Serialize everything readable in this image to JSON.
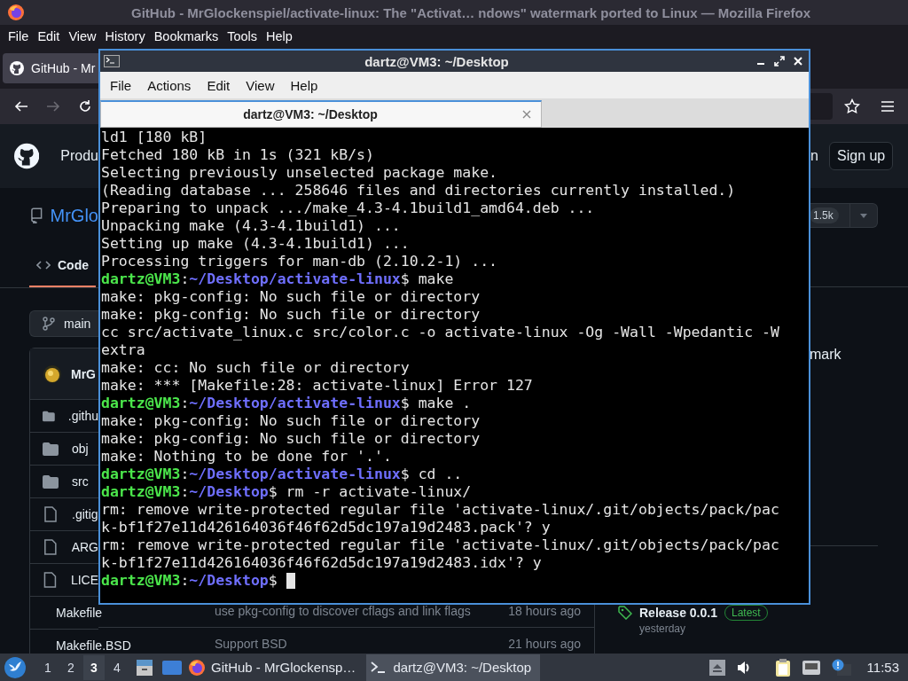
{
  "firefox": {
    "title": "GitHub - MrGlockenspiel/activate-linux: The \"Activat… ndows\" watermark ported to Linux — Mozilla Firefox",
    "menu": [
      {
        "label": "File"
      },
      {
        "label": "Edit"
      },
      {
        "label": "View"
      },
      {
        "label": "History"
      },
      {
        "label": "Bookmarks"
      },
      {
        "label": "Tools"
      },
      {
        "label": "Help"
      }
    ],
    "tab": {
      "label": "GitHub - Mr"
    },
    "forward_disabled": true
  },
  "github": {
    "header": {
      "nav_item": "Produ",
      "sign_in": "n",
      "sign_up": "Sign up"
    },
    "repo_name": "MrGlo",
    "tabs": [
      {
        "label": "Code",
        "selected": true
      }
    ],
    "star_count": "1.5k",
    "branch": "main",
    "about_text": "mark",
    "commit_author": "MrG",
    "files": [
      {
        "kind": "folder",
        "name": ".githu"
      },
      {
        "kind": "folder",
        "name": "obj"
      },
      {
        "kind": "folder",
        "name": "src"
      },
      {
        "kind": "file",
        "name": ".gitig"
      },
      {
        "kind": "file",
        "name": "ARG"
      },
      {
        "kind": "file",
        "name": "LICE"
      },
      {
        "kind": "file",
        "name": "Makefile"
      },
      {
        "kind": "file",
        "name": "Makefile.BSD"
      }
    ],
    "file_details": [
      {
        "message": "use pkg-config to discover cflags and link flags",
        "time": "18 hours ago"
      },
      {
        "message": "Support BSD",
        "time": "21 hours ago"
      }
    ],
    "release": {
      "name": "Release 0.0.1",
      "badge": "Latest",
      "date": "yesterday"
    }
  },
  "terminal": {
    "title": "dartz@VM3: ~/Desktop",
    "menu": [
      {
        "label": "File"
      },
      {
        "label": "Actions"
      },
      {
        "label": "Edit"
      },
      {
        "label": "View"
      },
      {
        "label": "Help"
      }
    ],
    "tabs": [
      {
        "label": "dartz@VM3: ~/Desktop",
        "selected": true
      }
    ],
    "lines": [
      {
        "kind": "output",
        "text": "ld1 [180 kB]"
      },
      {
        "kind": "output",
        "text": "Fetched 180 kB in 1s (321 kB/s)"
      },
      {
        "kind": "output",
        "text": "Selecting previously unselected package make."
      },
      {
        "kind": "output",
        "text": "(Reading database ... 258646 files and directories currently installed.)"
      },
      {
        "kind": "output",
        "text": "Preparing to unpack .../make_4.3-4.1build1_amd64.deb ..."
      },
      {
        "kind": "output",
        "text": "Unpacking make (4.3-4.1build1) ..."
      },
      {
        "kind": "output",
        "text": "Setting up make (4.3-4.1build1) ..."
      },
      {
        "kind": "output",
        "text": "Processing triggers for man-db (2.10.2-1) ..."
      },
      {
        "kind": "prompt",
        "user": "dartz@VM3",
        "sep": ":",
        "path": "~/Desktop/activate-linux",
        "tail": "$ make",
        "cursor": false
      },
      {
        "kind": "output",
        "text": "make: pkg-config: No such file or directory"
      },
      {
        "kind": "output",
        "text": "make: pkg-config: No such file or directory"
      },
      {
        "kind": "output",
        "text": "cc src/activate_linux.c src/color.c -o activate-linux -Og -Wall -Wpedantic -W"
      },
      {
        "kind": "output",
        "text": "extra"
      },
      {
        "kind": "output",
        "text": "make: cc: No such file or directory"
      },
      {
        "kind": "output",
        "text": "make: *** [Makefile:28: activate-linux] Error 127"
      },
      {
        "kind": "prompt",
        "user": "dartz@VM3",
        "sep": ":",
        "path": "~/Desktop/activate-linux",
        "tail": "$ make .",
        "cursor": false
      },
      {
        "kind": "output",
        "text": "make: pkg-config: No such file or directory"
      },
      {
        "kind": "output",
        "text": "make: pkg-config: No such file or directory"
      },
      {
        "kind": "output",
        "text": "make: Nothing to be done for '.'."
      },
      {
        "kind": "prompt",
        "user": "dartz@VM3",
        "sep": ":",
        "path": "~/Desktop/activate-linux",
        "tail": "$ cd ..",
        "cursor": false
      },
      {
        "kind": "prompt",
        "user": "dartz@VM3",
        "sep": ":",
        "path": "~/Desktop",
        "tail": "$ rm -r activate-linux/",
        "cursor": false
      },
      {
        "kind": "output",
        "text": "rm: remove write-protected regular file 'activate-linux/.git/objects/pack/pac"
      },
      {
        "kind": "output",
        "text": "k-bf1f27e11d426164036f46f62d5dc197a19d2483.pack'? y"
      },
      {
        "kind": "output",
        "text": "rm: remove write-protected regular file 'activate-linux/.git/objects/pack/pac"
      },
      {
        "kind": "output",
        "text": "k-bf1f27e11d426164036f46f62d5dc197a19d2483.idx'? y"
      },
      {
        "kind": "prompt",
        "user": "dartz@VM3",
        "sep": ":",
        "path": "~/Desktop",
        "tail": "$",
        "cursor": true
      }
    ]
  },
  "taskbar": {
    "workspaces": [
      {
        "label": "1",
        "selected": false
      },
      {
        "label": "2",
        "selected": false
      },
      {
        "label": "3",
        "selected": true
      },
      {
        "label": "4",
        "selected": false
      }
    ],
    "tasks": [
      {
        "kind": "browser",
        "label": "GitHub - MrGlockensp…",
        "selected": false
      },
      {
        "kind": "terminal",
        "label": "dartz@VM3: ~/Desktop",
        "selected": true
      }
    ],
    "clock": "11:53"
  }
}
